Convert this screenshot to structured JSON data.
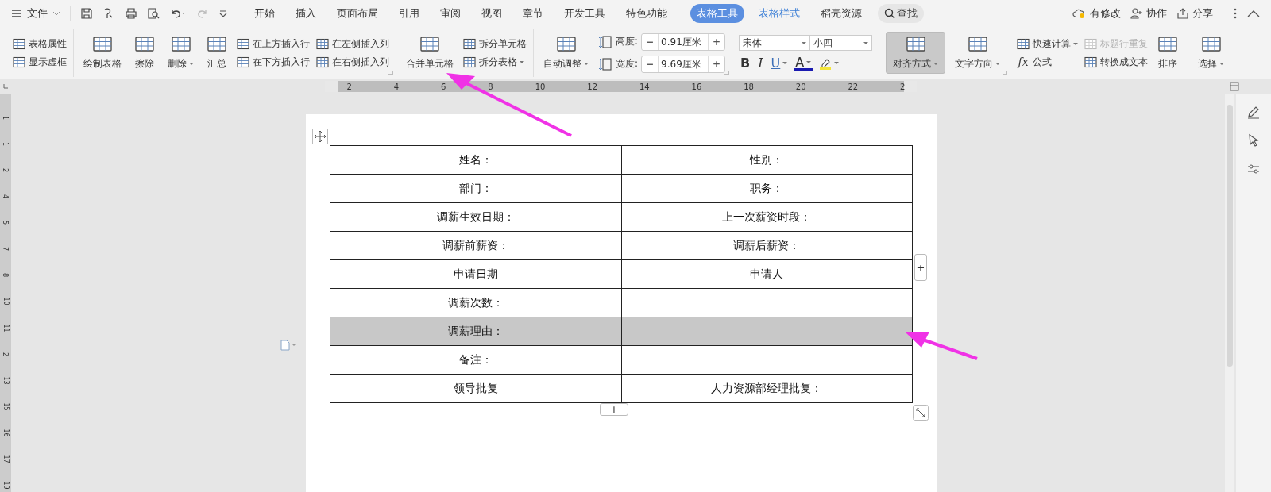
{
  "menu": {
    "label": "文件"
  },
  "tabs": [
    {
      "label": "开始",
      "selected": false,
      "kind": "plain"
    },
    {
      "label": "插入",
      "selected": false,
      "kind": "plain"
    },
    {
      "label": "页面布局",
      "selected": false,
      "kind": "plain"
    },
    {
      "label": "引用",
      "selected": false,
      "kind": "plain"
    },
    {
      "label": "审阅",
      "selected": false,
      "kind": "plain"
    },
    {
      "label": "视图",
      "selected": false,
      "kind": "plain"
    },
    {
      "label": "章节",
      "selected": false,
      "kind": "plain"
    },
    {
      "label": "开发工具",
      "selected": false,
      "kind": "plain"
    },
    {
      "label": "特色功能",
      "selected": false,
      "kind": "plain"
    },
    {
      "label": "表格工具",
      "selected": true,
      "kind": "context"
    },
    {
      "label": "表格样式",
      "selected": false,
      "kind": "context"
    },
    {
      "label": "稻壳资源",
      "selected": false,
      "kind": "plain"
    }
  ],
  "search": {
    "label": "查找"
  },
  "actions": [
    {
      "label": "有修改",
      "kind": "cloud"
    },
    {
      "label": "协作",
      "kind": "people"
    },
    {
      "label": "分享",
      "kind": "share"
    }
  ],
  "ribbon": [
    {
      "columns": [
        {
          "kind": "stack",
          "items": [
            {
              "label": "表格属性",
              "menu": false,
              "disabled": false
            },
            {
              "label": "显示虚框",
              "menu": false,
              "disabled": false
            }
          ]
        }
      ]
    },
    {
      "launcher": true,
      "columns": [
        {
          "kind": "large",
          "label": "绘制表格",
          "menu": false,
          "pressed": false
        },
        {
          "kind": "large",
          "label": "擦除",
          "menu": false,
          "pressed": false
        },
        {
          "kind": "large",
          "label": "删除",
          "menu": true,
          "pressed": false
        },
        {
          "kind": "large",
          "label": "汇总",
          "menu": false,
          "pressed": false
        },
        {
          "kind": "stack",
          "items": [
            {
              "label": "在上方插入行",
              "menu": false,
              "disabled": false
            },
            {
              "label": "在下方插入行",
              "menu": false,
              "disabled": false
            }
          ]
        },
        {
          "kind": "stack",
          "items": [
            {
              "label": "在左侧插入列",
              "menu": false,
              "disabled": false
            },
            {
              "label": "在右侧插入列",
              "menu": false,
              "disabled": false
            }
          ]
        }
      ]
    },
    {
      "columns": [
        {
          "kind": "large",
          "label": "合并单元格",
          "menu": false,
          "pressed": false
        },
        {
          "kind": "stack",
          "items": [
            {
              "label": "拆分单元格",
              "menu": false,
              "disabled": false
            },
            {
              "label": "拆分表格",
              "menu": true,
              "disabled": false
            }
          ]
        }
      ]
    },
    {
      "launcher": true,
      "columns": [
        {
          "kind": "large",
          "label": "自动调整",
          "menu": true,
          "pressed": false
        },
        {
          "kind": "spinners",
          "items": [
            {
              "label": "高度:",
              "value": "0.91厘米",
              "decrease": "−",
              "increase": "+"
            },
            {
              "label": "宽度:",
              "value": "9.69厘米",
              "decrease": "−",
              "increase": "+"
            }
          ]
        }
      ]
    },
    {
      "columns": [
        {
          "kind": "font",
          "font": "宋体",
          "size": "小四",
          "format": [
            {
              "kind": "bold",
              "text": "B",
              "menu": false
            },
            {
              "kind": "italic",
              "text": "I",
              "menu": false
            },
            {
              "kind": "underline",
              "text": "U",
              "menu": true
            },
            {
              "kind": "color",
              "text": "A",
              "menu": true
            },
            {
              "kind": "highlight",
              "menu": true
            }
          ]
        }
      ]
    },
    {
      "launcher": true,
      "columns": [
        {
          "kind": "large",
          "label": "对齐方式",
          "menu": true,
          "pressed": true
        },
        {
          "kind": "large",
          "label": "文字方向",
          "menu": true,
          "pressed": false
        }
      ]
    },
    {
      "columns": [
        {
          "kind": "stack",
          "items": [
            {
              "label": "快速计算",
              "menu": true,
              "disabled": false
            },
            {
              "label": "公式",
              "menu": false,
              "disabled": false,
              "glyph": "fx"
            }
          ]
        },
        {
          "kind": "stack",
          "items": [
            {
              "label": "标题行重复",
              "menu": false,
              "disabled": true
            },
            {
              "label": "转换成文本",
              "menu": false,
              "disabled": false
            }
          ]
        },
        {
          "kind": "large",
          "label": "排序",
          "menu": false,
          "pressed": false
        }
      ]
    },
    {
      "columns": [
        {
          "kind": "large",
          "label": "选择",
          "menu": true,
          "pressed": false
        }
      ]
    }
  ],
  "ruler": {
    "marks": [
      "2",
      "4",
      "6",
      "8",
      "10",
      "12",
      "14",
      "16",
      "18",
      "20",
      "22",
      "2"
    ]
  },
  "vertical_ruler": {
    "marks": [
      "1",
      "1",
      "2",
      "4",
      "5",
      "7",
      "8",
      "10",
      "11",
      "2",
      "13",
      "15",
      "16",
      "17",
      "19"
    ]
  },
  "table": {
    "add_column": "+",
    "add_row": "+",
    "rows": [
      {
        "cells": [
          "姓名：",
          "性别："
        ],
        "selected": false
      },
      {
        "cells": [
          "部门：",
          "职务："
        ],
        "selected": false
      },
      {
        "cells": [
          "调薪生效日期：",
          "上一次薪资时段："
        ],
        "selected": false
      },
      {
        "cells": [
          "调薪前薪资：",
          "调薪后薪资："
        ],
        "selected": false
      },
      {
        "cells": [
          "申请日期",
          "申请人"
        ],
        "selected": false
      },
      {
        "cells": [
          "调薪次数："
        ],
        "selected": false
      },
      {
        "cells": [
          "调薪理由："
        ],
        "selected": true
      },
      {
        "cells": [
          "备注："
        ],
        "selected": false
      },
      {
        "cells": [
          "领导批复",
          "人力资源部经理批复："
        ],
        "selected": false
      }
    ]
  }
}
